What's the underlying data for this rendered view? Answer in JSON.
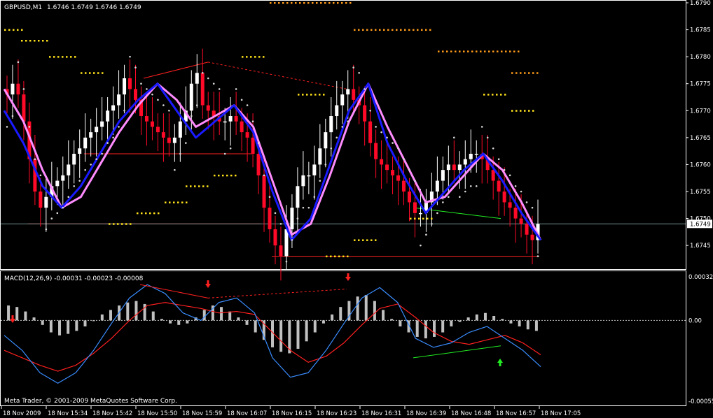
{
  "window": {
    "symbol_label": "GBPUSD,M1",
    "ohlc_label": "1.6746 1.6749 1.6746 1.6749",
    "copyright": "Meta Trader, © 2001-2009 MetaQuotes Software Corp."
  },
  "colors": {
    "background": "#000000",
    "frame": "#ffffff",
    "bull_candle": "#ffffff",
    "bear_candle": "#ff0a28",
    "ma_fast": "#1a1aff",
    "ma_slow": "#ff8cff",
    "parabolic_sar": "#d8d8d8",
    "pivot_upper": "#ff9a1a",
    "pivot_lower": "#ffe21a",
    "support_line": "#ff2020",
    "divergence": "#22ee22",
    "histogram": "#c0c0c0",
    "macd_main": "#3a8dff",
    "macd_signal": "#ff2020"
  },
  "chart_data": [
    {
      "type": "candlestick",
      "title": "GBPUSD,M1",
      "ylim": [
        1.6741,
        1.679
      ],
      "y_ticks": [
        "1.6790",
        "1.6785",
        "1.6780",
        "1.6775",
        "1.6770",
        "1.6765",
        "1.6760",
        "1.6755",
        "1.6750",
        "1.6745"
      ],
      "current_price": "1.6749",
      "x_tick_labels": [
        "18 Nov 2009",
        "18 Nov 15:34",
        "18 Nov 15:42",
        "18 Nov 15:50",
        "18 Nov 15:59",
        "18 Nov 16:07",
        "18 Nov 16:15",
        "18 Nov 16:23",
        "18 Nov 16:31",
        "18 Nov 16:39",
        "18 Nov 16:48",
        "18 Nov 16:57",
        "18 Nov 17:05"
      ],
      "closes": [
        1.6773,
        1.6775,
        1.6773,
        1.6768,
        1.6761,
        1.6755,
        1.6752,
        1.6754,
        1.6756,
        1.6757,
        1.6758,
        1.676,
        1.6762,
        1.6763,
        1.6765,
        1.6766,
        1.6767,
        1.6768,
        1.677,
        1.6771,
        1.6773,
        1.6776,
        1.6774,
        1.6772,
        1.6769,
        1.6768,
        1.6767,
        1.6766,
        1.6765,
        1.6764,
        1.6765,
        1.6768,
        1.677,
        1.6775,
        1.6777,
        1.6771,
        1.677,
        1.6769,
        1.6768,
        1.6768,
        1.6769,
        1.6768,
        1.6766,
        1.6765,
        1.6762,
        1.6758,
        1.6752,
        1.6748,
        1.6745,
        1.6743,
        1.6748,
        1.6752,
        1.6756,
        1.6758,
        1.6758,
        1.676,
        1.6763,
        1.6766,
        1.6769,
        1.6771,
        1.6773,
        1.6774,
        1.6772,
        1.6771,
        1.6768,
        1.6764,
        1.6761,
        1.676,
        1.6759,
        1.6758,
        1.6757,
        1.6755,
        1.6753,
        1.6751,
        1.6751,
        1.6753,
        1.6755,
        1.6757,
        1.6759,
        1.676,
        1.6759,
        1.676,
        1.6761,
        1.6762,
        1.6762,
        1.6761,
        1.6759,
        1.6757,
        1.6755,
        1.6753,
        1.6752,
        1.675,
        1.6749,
        1.6747,
        1.6746,
        1.6749
      ],
      "support_levels": [
        1.6749,
        1.6762,
        1.6743
      ],
      "series": [
        {
          "name": "",
          "indicator": "fast moving average",
          "trend": [
            1.677,
            1.6764,
            1.6756,
            1.6752,
            1.6756,
            1.6762,
            1.6768,
            1.6772,
            1.6775,
            1.677,
            1.6765,
            1.6768,
            1.6771,
            1.6766,
            1.6755,
            1.6746,
            1.675,
            1.676,
            1.677,
            1.6775,
            1.6764,
            1.6757,
            1.6751,
            1.6755,
            1.6759,
            1.6762,
            1.6757,
            1.6751,
            1.6746
          ]
        },
        {
          "name": "",
          "indicator": "slow moving average",
          "trend": [
            1.6774,
            1.6768,
            1.6759,
            1.6752,
            1.6754,
            1.676,
            1.6766,
            1.6771,
            1.6775,
            1.6772,
            1.6767,
            1.6769,
            1.6771,
            1.6767,
            1.6757,
            1.6747,
            1.6749,
            1.6758,
            1.6768,
            1.6775,
            1.6767,
            1.676,
            1.6753,
            1.6754,
            1.6758,
            1.6762,
            1.6759,
            1.6753,
            1.6746
          ]
        }
      ]
    },
    {
      "type": "bar",
      "title": "MACD(12,26,9) -0.00031 -0.00023 -0.00008",
      "ylim": [
        -0.00055,
        0.00032
      ],
      "y_ticks": [
        "0.00032",
        "0.00",
        "-0.00055"
      ],
      "histogram": [
        0.0001,
        9e-05,
        6e-05,
        2e-05,
        -3e-05,
        -8e-05,
        -0.0001,
        -9e-05,
        -7e-05,
        -4e-05,
        0.0,
        4e-05,
        7e-05,
        0.0001,
        0.00012,
        0.00013,
        0.00011,
        6e-05,
        1e-05,
        -2e-05,
        -3e-05,
        -2e-05,
        2e-05,
        7e-05,
        0.0001,
        9e-05,
        6e-05,
        2e-05,
        -3e-05,
        -8e-05,
        -0.00013,
        -0.00018,
        -0.00021,
        -0.00022,
        -0.00019,
        -0.00014,
        -8e-05,
        -2e-05,
        4e-05,
        9e-05,
        0.00013,
        0.00016,
        0.00017,
        0.00013,
        7e-05,
        1e-05,
        -4e-05,
        -8e-05,
        -0.00011,
        -0.00012,
        -0.00011,
        -8e-05,
        -4e-05,
        -1e-05,
        2e-05,
        4e-05,
        5e-05,
        3e-05,
        1e-05,
        -2e-05,
        -4e-05,
        -6e-05,
        -7e-05
      ],
      "series": [
        {
          "name": "",
          "values": [
            -0.0001,
            -0.0002,
            -0.00035,
            -0.00042,
            -0.00035,
            -0.0002,
            -2e-05,
            0.00015,
            0.00024,
            0.00018,
            5e-05,
            0.0,
            0.00012,
            0.00015,
            5e-05,
            -0.00025,
            -0.00038,
            -0.00035,
            -0.0002,
            -2e-05,
            0.00015,
            0.00022,
            0.00012,
            -0.00012,
            -0.00018,
            -0.00015,
            -8e-05,
            -4e-05,
            -0.00012,
            -0.0002,
            -0.00031
          ]
        },
        {
          "name": "",
          "values": [
            -0.0002,
            -0.00025,
            -0.0003,
            -0.00034,
            -0.0003,
            -0.00022,
            -0.00012,
            0.0,
            0.0001,
            0.00012,
            0.0001,
            8e-05,
            5e-05,
            6e-05,
            4e-05,
            -8e-05,
            -0.0002,
            -0.00028,
            -0.00024,
            -0.00015,
            -3e-05,
            8e-05,
            0.00011,
            2e-05,
            -8e-05,
            -0.00014,
            -0.00016,
            -0.00013,
            -0.0001,
            -0.00015,
            -0.00023
          ]
        }
      ]
    }
  ]
}
